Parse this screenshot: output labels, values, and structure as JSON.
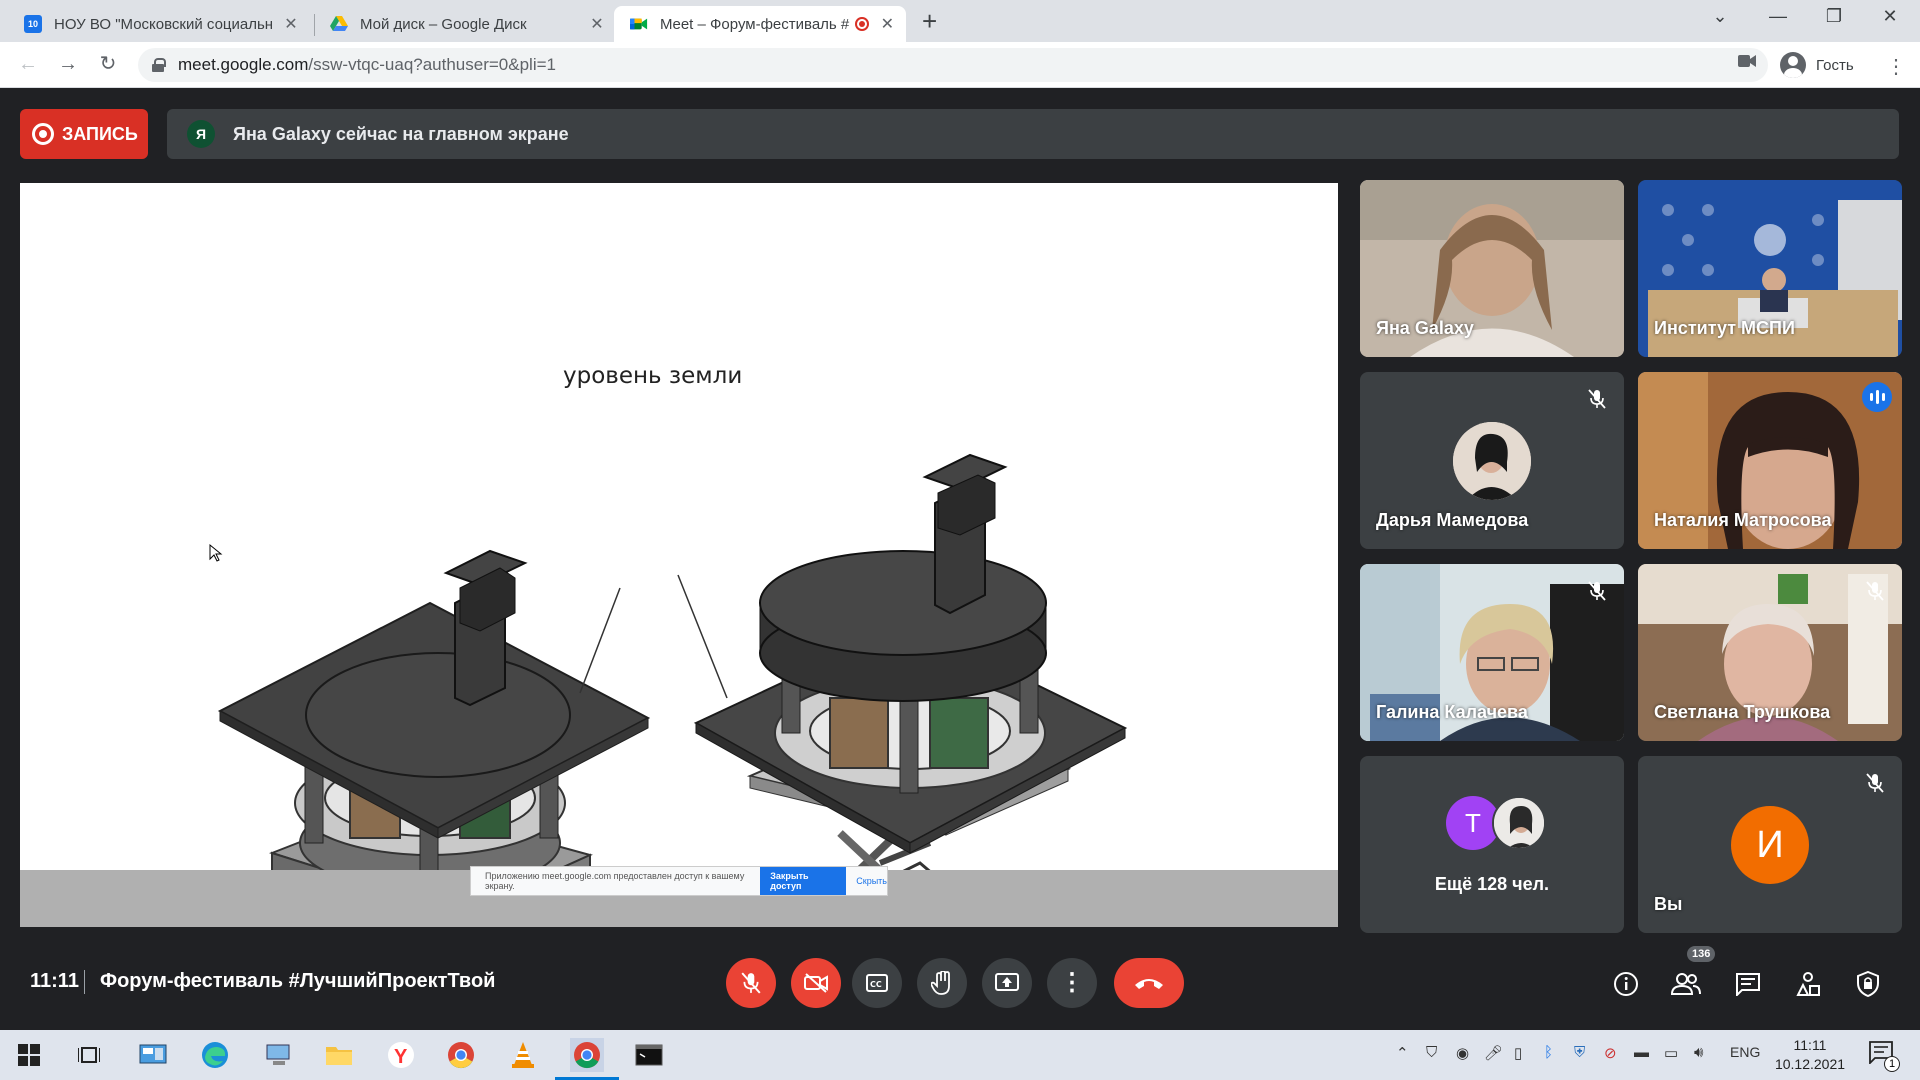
{
  "browser": {
    "tabs": [
      {
        "title": "НОУ ВО \"Московский социальн",
        "favicon_color": "#1a73e8",
        "favicon_text": "10"
      },
      {
        "title": "Мой диск – Google Диск",
        "favicon_color": "#fbbc04",
        "favicon_text": ""
      },
      {
        "title": "Meet – Форум-фестиваль #",
        "favicon_color": "#00832d",
        "favicon_text": ""
      }
    ],
    "url_host": "meet.google.com",
    "url_path": "/ssw-vtqc-uaq?authuser=0&pli=1",
    "profile_label": "Гость"
  },
  "meet": {
    "record_label": "ЗАПИСЬ",
    "banner_avatar": "Я",
    "banner_text": "Яна Galaxy сейчас на главном экране",
    "slide": {
      "ground_label": "уровень земли",
      "share_notice": "Приложению meet.google.com предоставлен доступ к вашему экрану.",
      "stop_sharing": "Закрыть доступ",
      "hide": "Скрыть"
    },
    "participants": [
      {
        "name": "Яна Galaxy",
        "muted": false
      },
      {
        "name": "Институт МСПИ",
        "muted": false
      },
      {
        "name": "Дарья Мамедова",
        "muted": true
      },
      {
        "name": "Наталия Матросова",
        "muted": false,
        "speaking": true
      },
      {
        "name": "Галина Калачева",
        "muted": true
      },
      {
        "name": "Светлана Трушкова",
        "muted": true
      },
      {
        "name": "Ещё 128 чел.",
        "avatar_letter": "Т"
      },
      {
        "name": "Вы",
        "avatar_letter": "И",
        "muted": true
      }
    ],
    "time": "11:11",
    "title": "Форум-фестиваль #ЛучшийПроектТвой",
    "participant_count": "136",
    "colors": {
      "red": "#ea4335",
      "blue": "#1a73e8",
      "orange": "#f26d00",
      "purple": "#a142f4"
    }
  },
  "taskbar": {
    "lang": "ENG",
    "time": "11:11",
    "date": "10.12.2021",
    "notifications": "1"
  }
}
